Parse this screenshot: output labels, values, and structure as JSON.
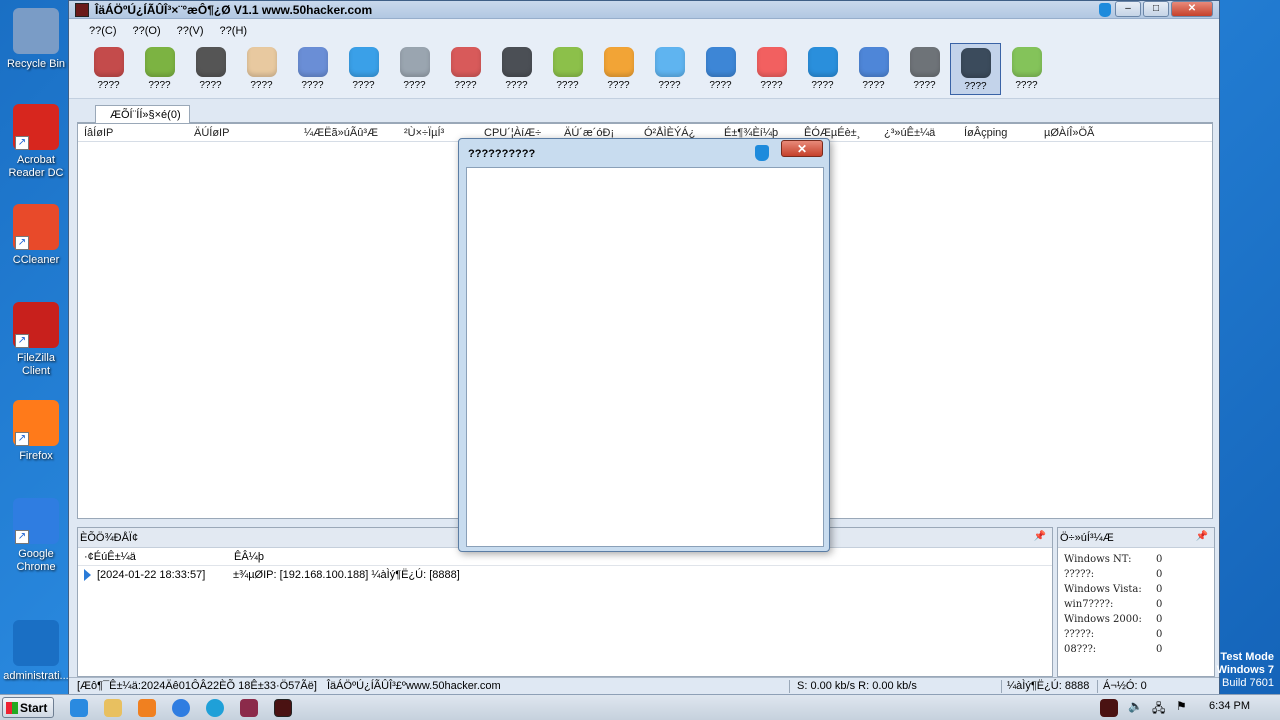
{
  "desktop": {
    "icons": [
      {
        "label": "Recycle Bin",
        "color": "#7a9cc6"
      },
      {
        "label": "Acrobat Reader DC",
        "color": "#d7261e"
      },
      {
        "label": "CCleaner",
        "color": "#e84a2a"
      },
      {
        "label": "FileZilla Client",
        "color": "#c8201c"
      },
      {
        "label": "Firefox",
        "color": "#ff7a1a"
      },
      {
        "label": "Google Chrome",
        "color": "#2f7de1"
      },
      {
        "label": "administrati...",
        "color": "#1a6fc4"
      }
    ]
  },
  "window": {
    "title": "ÎäÁÖºÚ¿ÍÃÛÎ³×¨°æÔ¶¿Ø V1.1 www.50hacker.com",
    "menu": [
      "??(C)",
      "??(O)",
      "??(V)",
      "??(H)"
    ],
    "toolbar": [
      {
        "label": "????",
        "color": "#c44b4b"
      },
      {
        "label": "????",
        "color": "#7cb342"
      },
      {
        "label": "????",
        "color": "#555555"
      },
      {
        "label": "????",
        "color": "#e8c9a0"
      },
      {
        "label": "????",
        "color": "#6a8ed6"
      },
      {
        "label": "????",
        "color": "#3aa0e8"
      },
      {
        "label": "????",
        "color": "#9aa5b0"
      },
      {
        "label": "????",
        "color": "#d85a5a"
      },
      {
        "label": "????",
        "color": "#4b4f55"
      },
      {
        "label": "????",
        "color": "#8cc04a"
      },
      {
        "label": "????",
        "color": "#f2a436"
      },
      {
        "label": "????",
        "color": "#5fb4f0"
      },
      {
        "label": "????",
        "color": "#3d86d6"
      },
      {
        "label": "????",
        "color": "#f26060"
      },
      {
        "label": "????",
        "color": "#2a8fdc"
      },
      {
        "label": "????",
        "color": "#4e86d8"
      },
      {
        "label": "????",
        "color": "#6e7378"
      },
      {
        "label": "????",
        "color": "#3b4b5c"
      },
      {
        "label": "????",
        "color": "#84c35a"
      }
    ],
    "active_tool_index": 17,
    "tab_label": "ÆÕÍ¨ÍÍ»§×é(0)",
    "columns": [
      "ÍâÍøIP",
      "ÄÚÍøIP",
      "¼ÆËã»úÃû³Æ",
      "²Ù×÷ÏµÍ³",
      "CPU´¦ÀíÆ÷",
      "ÄÚ´æ´óÐ¡",
      "Ó²ÅÌÈÝÁ¿",
      "É±¶¾Èí¼þ",
      "ÊÓÆµÉè±¸",
      "¿³»úÊ±¼ä",
      "ÍøÂçping",
      "µØÀíÎ»ÖÃ"
    ],
    "log_panel": {
      "title": "ÈÕÖ¾ÐÅÏ¢",
      "col_time": "·¢ÉúÊ±¼ä",
      "col_event": "ÊÂ¼þ",
      "rows": [
        {
          "time": "[2024-01-22 18:33:57]",
          "event": "±¾µØIP: [192.168.100.188] ¼àÌý¶Ë¿Ú: [8888]"
        }
      ]
    },
    "os_panel": {
      "title": "Ö÷»úÍ³¼Æ",
      "rows": [
        {
          "name": "Windows NT:",
          "count": "0"
        },
        {
          "name": "?????:",
          "count": "0"
        },
        {
          "name": "Windows Vista:",
          "count": "0"
        },
        {
          "name": "win7????:",
          "count": "0"
        },
        {
          "name": "Windows 2000:",
          "count": "0"
        },
        {
          "name": "?????:",
          "count": "0"
        },
        {
          "name": "08???:",
          "count": "0"
        }
      ]
    },
    "status": {
      "left": "[Æô¶¯Ê±¼ä:2024Äê01ÔÂ22ÈÕ 18Ê±33·Ö57Ãë]",
      "site": "ÎäÁÖºÚ¿ÍÃÛÎ³£ºwww.50hacker.com",
      "speed": "S: 0.00 kb/s R: 0.00 kb/s",
      "port": "¼àÌý¶Ë¿Ú: 8888",
      "online": "Á¬½Ó: 0"
    }
  },
  "dialog": {
    "title": "??????????",
    "close": "✕"
  },
  "taskbar": {
    "start_label": "Start",
    "clock": "6:34 PM",
    "watermark_lines": [
      "Test Mode",
      "Windows 7",
      "Build 7601"
    ]
  }
}
